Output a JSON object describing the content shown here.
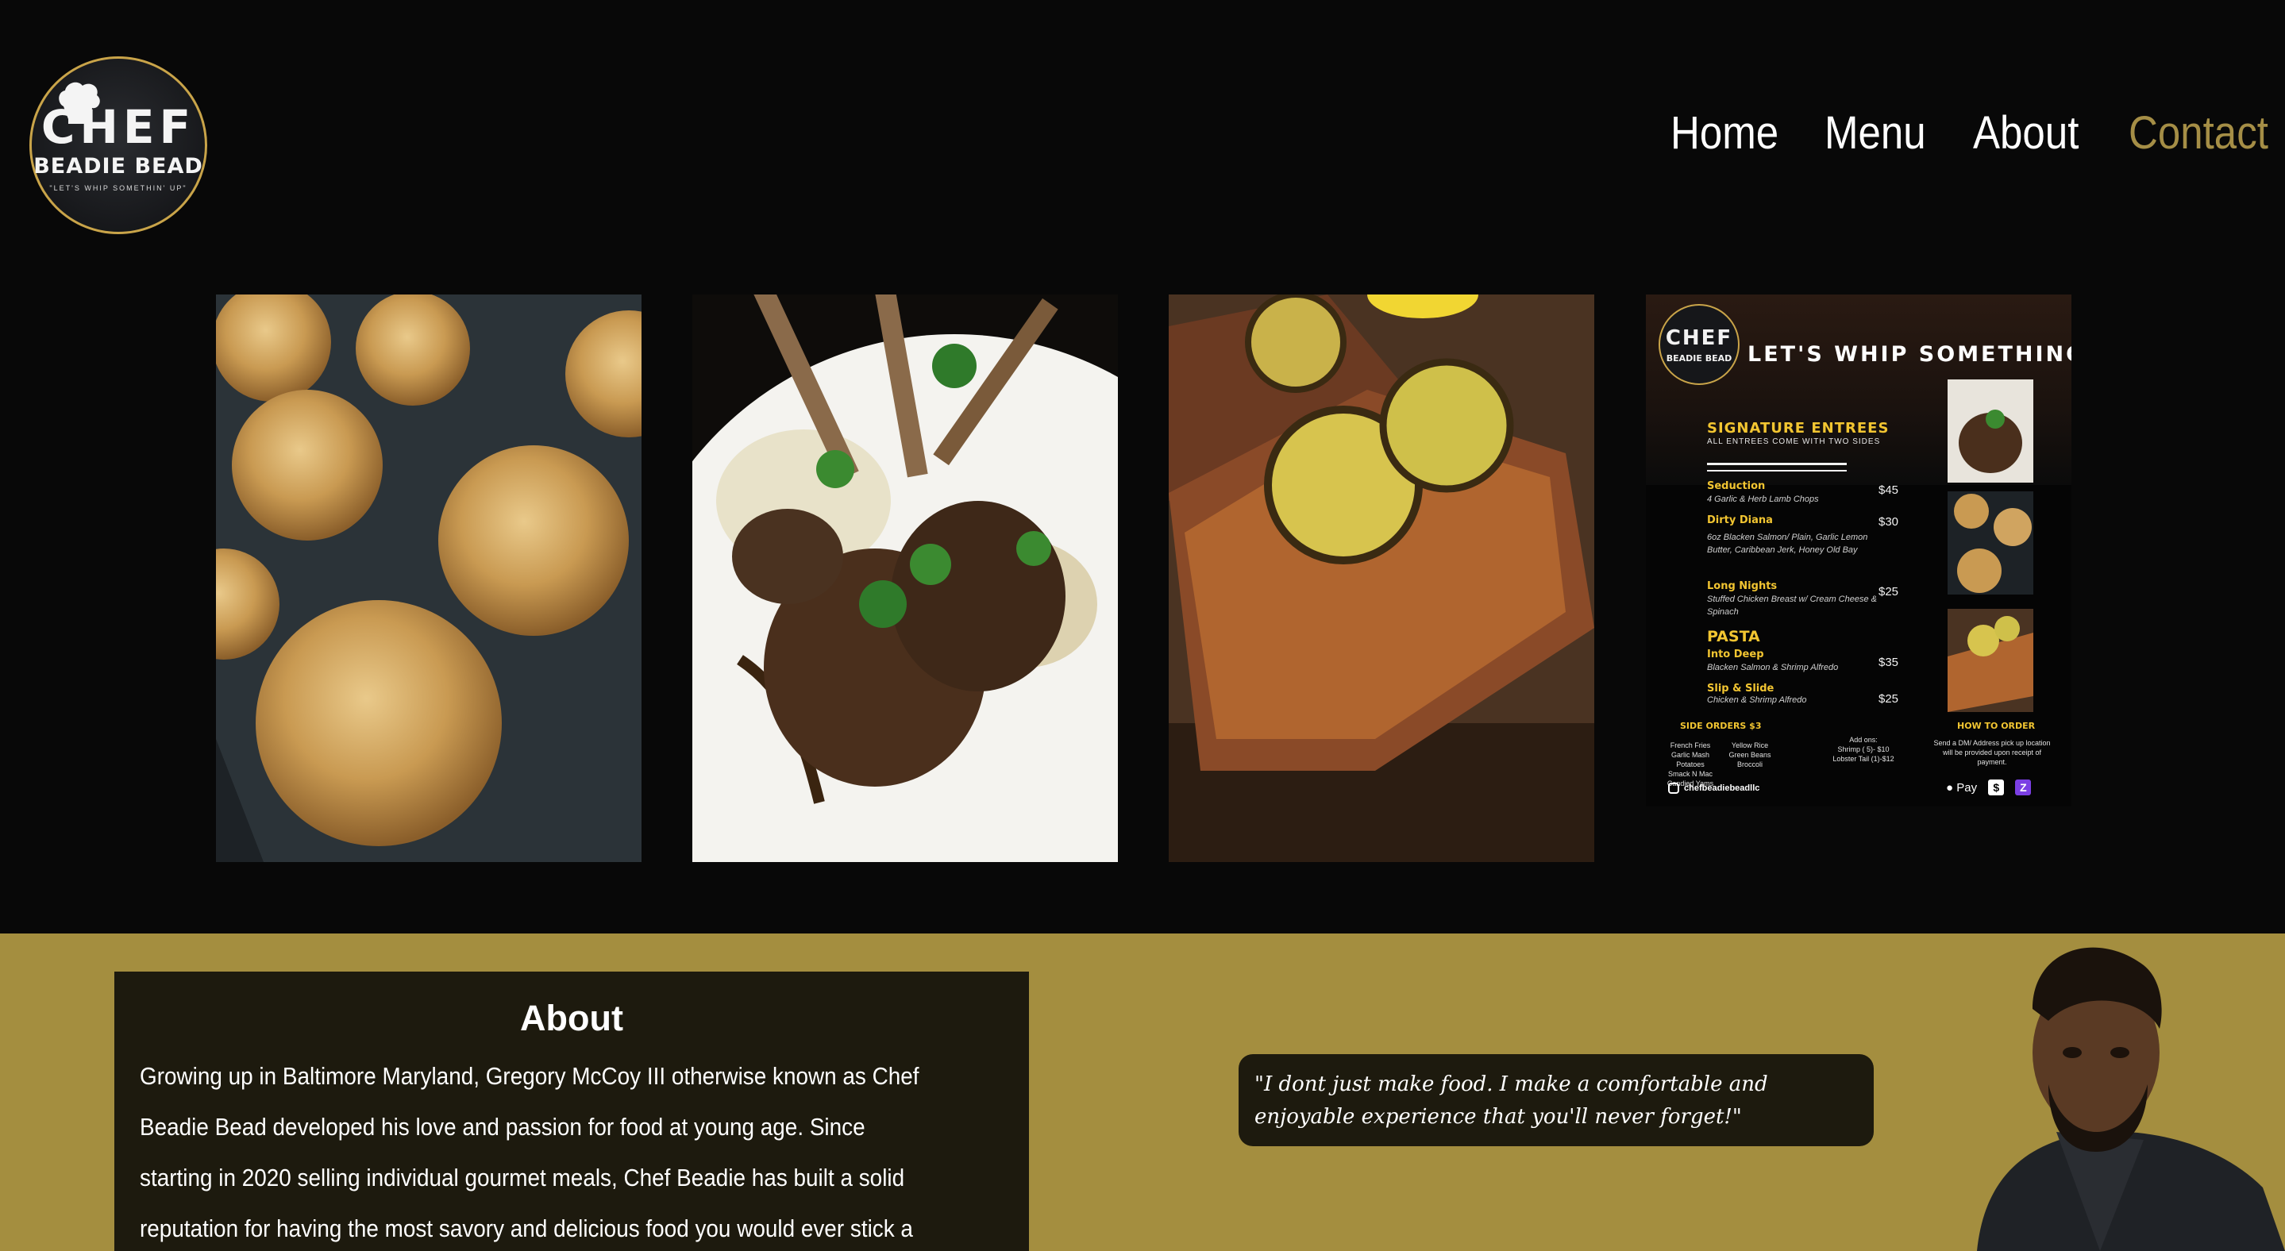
{
  "brand": {
    "logo_line1": "CHEF",
    "logo_line2": "BEADIE BEAD",
    "logo_tagline": "\"LET'S WHIP SOMETHIN' UP\""
  },
  "nav": {
    "items": [
      {
        "label": "Home",
        "active": false
      },
      {
        "label": "Menu",
        "active": false
      },
      {
        "label": "About",
        "active": false
      },
      {
        "label": "Contact",
        "active": true
      }
    ],
    "active_color": "#a58e46"
  },
  "gallery": {
    "photos": [
      {
        "subject": "crab cakes on a baking tray"
      },
      {
        "subject": "herb lamb chops on a white plate"
      },
      {
        "subject": "blackened salmon with grilled lemon slices"
      }
    ],
    "flyer": {
      "logo_line1": "CHEF",
      "logo_line2": "BEADIE BEAD",
      "headline": "LET'S WHIP SOMETHING UP",
      "section_title": "SIGNATURE ENTREES",
      "section_subtitle": "ALL ENTREES COME WITH TWO SIDES",
      "entrees": [
        {
          "name": "Seduction",
          "desc": "4 Garlic & Herb Lamb Chops",
          "price": "$45"
        },
        {
          "name": "Dirty Diana",
          "desc": "6oz Blacken Salmon/ Plain, Garlic Lemon Butter, Caribbean Jerk, Honey Old Bay",
          "price": "$30"
        },
        {
          "name": "Long Nights",
          "desc": "Stuffed Chicken Breast w/ Cream Cheese & Spinach",
          "price": "$25"
        }
      ],
      "pasta_title": "PASTA",
      "pasta": [
        {
          "name": "Into Deep",
          "desc": "Blacken Salmon & Shrimp Alfredo",
          "price": "$35"
        },
        {
          "name": "Slip & Slide",
          "desc": "Chicken & Shrimp Alfredo",
          "price": "$25"
        }
      ],
      "side_orders_title": "SIDE ORDERS $3",
      "sides_col1": "French Fries\nGarlic Mash Potatoes\nSmack N Mac\nCandied Yams",
      "sides_col2": "Yellow Rice\nGreen Beans\nBroccoli",
      "addons_title": "Add ons:",
      "addons": "Shrimp ( 5)- $10\nLobster Tail (1)-$12",
      "how_to_order_title": "HOW TO ORDER",
      "how_to_order": "Send a DM/ Address pick up location will be provided upon receipt of payment.",
      "instagram": "chefbeadiebeadllc",
      "payments": [
        "Pay",
        "$",
        "Z"
      ]
    }
  },
  "about": {
    "heading": "About",
    "body": "Growing up in Baltimore Maryland, Gregory McCoy III otherwise known as Chef Beadie Bead developed his love and passion for food at young age. Since starting in 2020 selling individual gourmet meals, Chef Beadie has built a solid reputation for having the most savory and delicious food you would ever stick a fork in. Chef Beadie is now doing private chef dining and catering",
    "quote": "\"I dont just make food. I make a comfortable and enjoyable experience that you'll never forget!\""
  },
  "colors": {
    "page_bg": "#080808",
    "gold_band": "#a48e3f",
    "card_bg": "#1d1a0e",
    "flyer_accent": "#f2c531"
  }
}
